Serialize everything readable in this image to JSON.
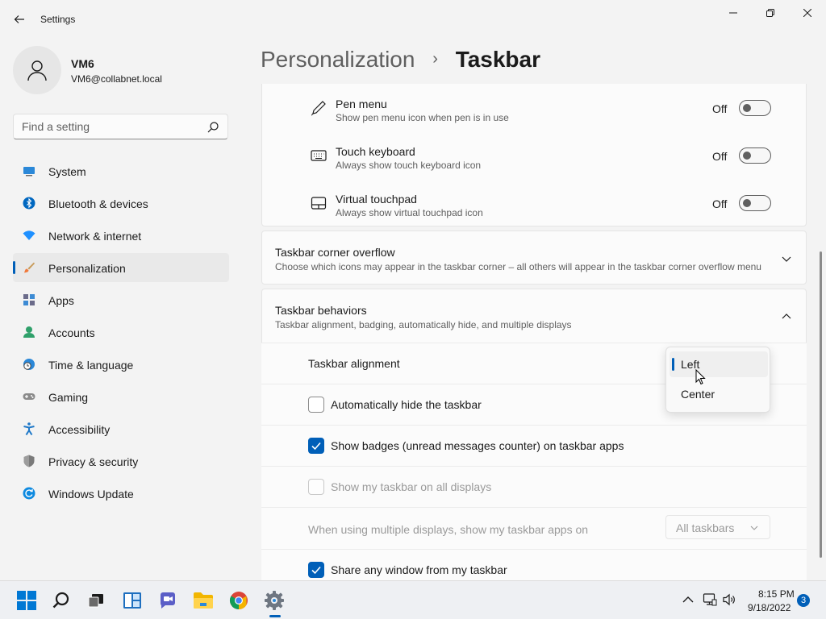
{
  "window": {
    "title": "Settings"
  },
  "profile": {
    "name": "VM6",
    "email": "VM6@collabnet.local"
  },
  "search": {
    "placeholder": "Find a setting"
  },
  "nav": {
    "items": [
      {
        "label": "System",
        "icon": "system-icon"
      },
      {
        "label": "Bluetooth & devices",
        "icon": "bluetooth-icon"
      },
      {
        "label": "Network & internet",
        "icon": "wifi-icon"
      },
      {
        "label": "Personalization",
        "icon": "brush-icon",
        "selected": true
      },
      {
        "label": "Apps",
        "icon": "apps-icon"
      },
      {
        "label": "Accounts",
        "icon": "accounts-icon"
      },
      {
        "label": "Time & language",
        "icon": "clock-globe-icon"
      },
      {
        "label": "Gaming",
        "icon": "gamepad-icon"
      },
      {
        "label": "Accessibility",
        "icon": "accessibility-icon"
      },
      {
        "label": "Privacy & security",
        "icon": "shield-icon"
      },
      {
        "label": "Windows Update",
        "icon": "update-icon"
      }
    ]
  },
  "breadcrumb": {
    "parent": "Personalization",
    "separator": "›",
    "current": "Taskbar"
  },
  "corner_icons": [
    {
      "title": "Pen menu",
      "subtitle": "Show pen menu icon when pen is in use",
      "state": "Off",
      "icon": "pen-icon"
    },
    {
      "title": "Touch keyboard",
      "subtitle": "Always show touch keyboard icon",
      "state": "Off",
      "icon": "keyboard-icon"
    },
    {
      "title": "Virtual touchpad",
      "subtitle": "Always show virtual touchpad icon",
      "state": "Off",
      "icon": "touchpad-icon"
    }
  ],
  "overflow": {
    "title": "Taskbar corner overflow",
    "subtitle": "Choose which icons may appear in the taskbar corner – all others will appear in the taskbar corner overflow menu"
  },
  "behaviors": {
    "title": "Taskbar behaviors",
    "subtitle": "Taskbar alignment, badging, automatically hide, and multiple displays",
    "alignment_label": "Taskbar alignment",
    "alignment_options": [
      "Left",
      "Center"
    ],
    "alignment_selected": "Left",
    "auto_hide": "Automatically hide the taskbar",
    "badges": "Show badges (unread messages counter) on taskbar apps",
    "all_displays": "Show my taskbar on all displays",
    "multi_display_label": "When using multiple displays, show my taskbar apps on",
    "multi_display_value": "All taskbars",
    "share_window": "Share any window from my taskbar"
  },
  "taskbar": {
    "time": "8:15 PM",
    "date": "9/18/2022",
    "notifications": "3"
  },
  "colors": {
    "accent": "#005fb8",
    "background": "#f3f3f3",
    "card": "#fbfbfb"
  }
}
